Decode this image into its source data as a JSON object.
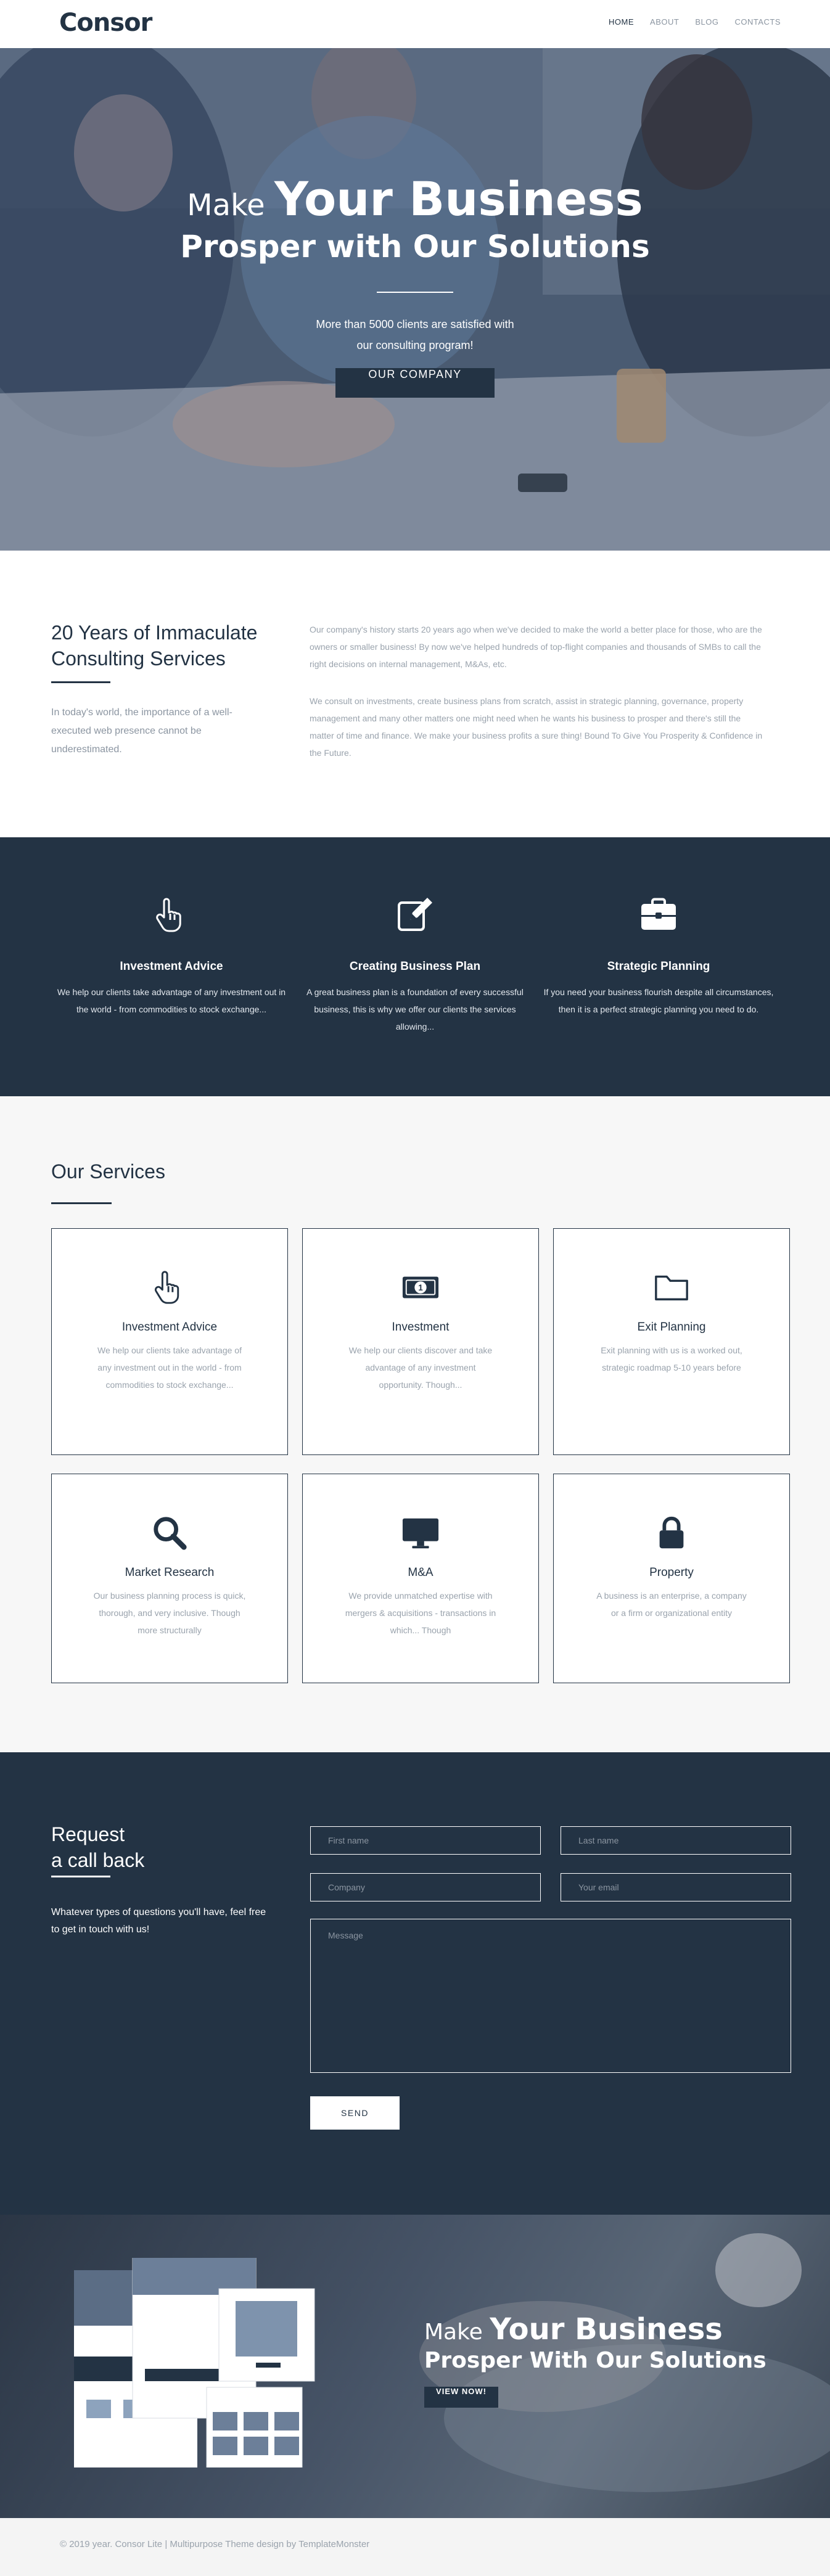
{
  "header": {
    "logo": "Consor",
    "nav": [
      "HOME",
      "ABOUT",
      "BLOG",
      "CONTACTS"
    ]
  },
  "hero": {
    "line1_small": "Make",
    "line1_big": "Your Business",
    "line2": "Prosper with Our Solutions",
    "subtitle_1": "More than 5000 clients are satisfied with",
    "subtitle_2": "our consulting program!",
    "button": "OUR COMPANY"
  },
  "about": {
    "title": "20 Years of Immaculate Consulting Services",
    "lead": "In today's world, the importance of a well-executed web presence cannot be underestimated.",
    "p1": "Our company's history starts 20 years ago when we've decided to make the world a better place for those, who are the owners or smaller business! By now we've helped hundreds of top-flight companies and thousands of SMBs to call the right decisions on internal management, M&As, etc.",
    "p2": "We consult on investments, create business plans from scratch, assist in strategic planning, governance, property management and many other matters one might need when he wants his business to prosper and there's still the matter of time and finance. We make your business profits a sure thing! Bound To Give You Prosperity & Confidence in the Future."
  },
  "features": [
    {
      "icon": "pointer-hand-icon",
      "title": "Investment Advice",
      "text": "We help our clients take advantage of any investment out in the world - from commodities to stock exchange..."
    },
    {
      "icon": "edit-document-icon",
      "title": "Creating Business Plan",
      "text": "A great business plan is a foundation of every successful business, this is why we offer our clients the services allowing..."
    },
    {
      "icon": "briefcase-icon",
      "title": "Strategic Planning",
      "text": "If you need your business flourish despite all circumstances, then it is a perfect strategic planning you need to do."
    }
  ],
  "services": {
    "title": "Our Services",
    "cards": [
      {
        "icon": "pointer-hand-icon",
        "title": "Investment Advice",
        "text": "We help our clients take advantage of any investment out in the world - from commodities to stock exchange..."
      },
      {
        "icon": "money-bill-icon",
        "title": "Investment",
        "text": "We help our clients discover and take advantage of any investment opportunity. Though..."
      },
      {
        "icon": "folder-icon",
        "title": "Exit Planning",
        "text": "Exit planning with us is a worked out, strategic roadmap 5-10 years before"
      },
      {
        "icon": "search-icon",
        "title": "Market Research",
        "text": "Our business planning process is quick, thorough, and very inclusive. Though more structurally"
      },
      {
        "icon": "monitor-icon",
        "title": "M&A",
        "text": "We provide unmatched expertise with mergers & acquisitions - transactions in which... Though"
      },
      {
        "icon": "lock-icon",
        "title": "Property",
        "text": "A business is an enterprise, a company or a firm or organizational entity"
      }
    ]
  },
  "request": {
    "title_1": "Request",
    "title_2": "a call back",
    "text": "Whatever types of questions you'll have, feel free to get in touch with us!",
    "first_name": "First name",
    "last_name": "Last name",
    "company": "Company",
    "email": "Your email",
    "message": "Message",
    "send": "SEND"
  },
  "promo": {
    "line1_small": "Make",
    "line1_big": "Your Business",
    "line2": "Prosper With Our Solutions",
    "button": "VIEW NOW!"
  },
  "footer": {
    "text": "© 2019 year. Consor Lite | Multipurpose Theme design by TemplateMonster"
  },
  "colors": {
    "navy": "#233344",
    "light_bg": "#f7f7f7",
    "muted_text": "#9aa3ad"
  }
}
